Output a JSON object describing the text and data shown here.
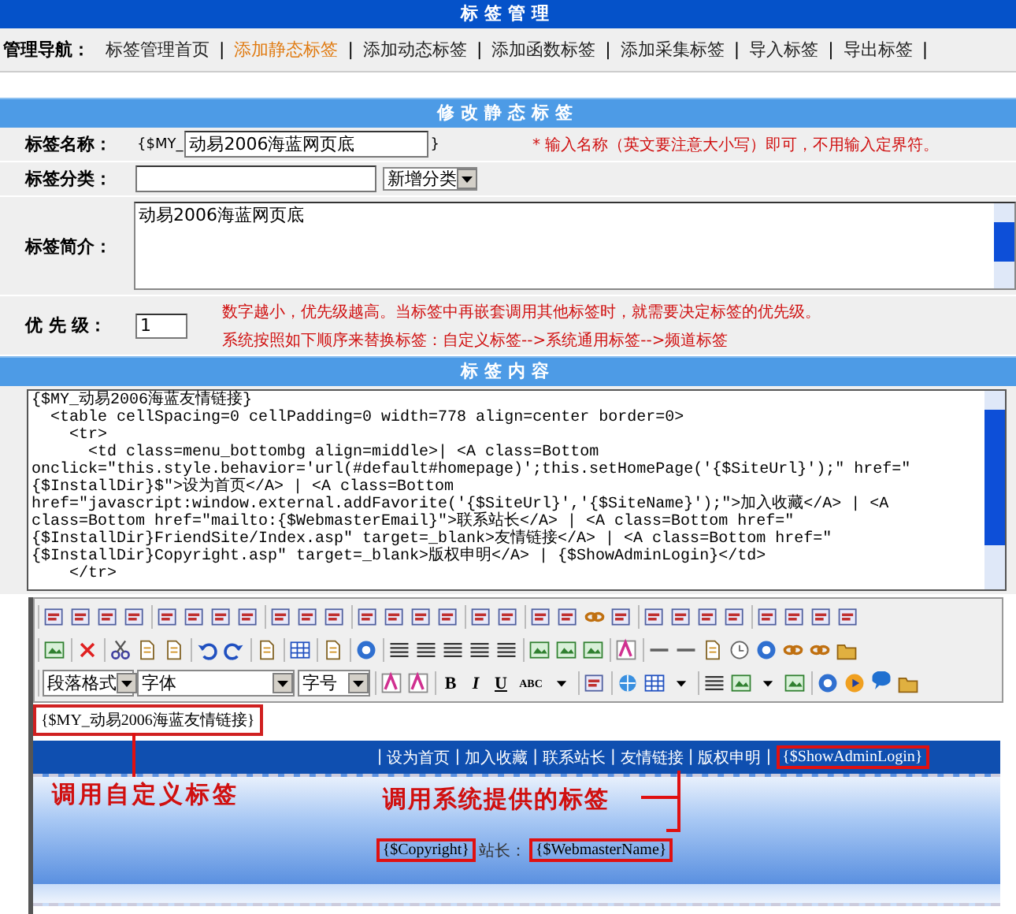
{
  "header": {
    "title": "标签管理"
  },
  "nav": {
    "label": "管理导航：",
    "separator": "|",
    "items": [
      {
        "label": "标签管理首页",
        "selected": false
      },
      {
        "label": "添加静态标签",
        "selected": true
      },
      {
        "label": "添加动态标签",
        "selected": false
      },
      {
        "label": "添加函数标签",
        "selected": false
      },
      {
        "label": "添加采集标签",
        "selected": false
      },
      {
        "label": "导入标签",
        "selected": false
      },
      {
        "label": "导出标签",
        "selected": false
      }
    ]
  },
  "form": {
    "title": "修改静态标签",
    "name": {
      "label": "标签名称：",
      "prefix": "{$MY_",
      "value": "动易2006海蓝网页底",
      "suffix": "}",
      "hint": "* 输入名称（英文要注意大小写）即可，不用输入定界符。"
    },
    "category": {
      "label": "标签分类：",
      "select": "新增分类"
    },
    "intro": {
      "label": "标签简介：",
      "value": "动易2006海蓝网页底"
    },
    "priority": {
      "label": "优 先 级：",
      "value": "1",
      "hints": [
        "数字越小，优先级越高。当标签中再嵌套调用其他标签时，就需要决定标签的优先级。",
        "系统按照如下顺序来替换标签：自定义标签-->系统通用标签-->频道标签"
      ]
    }
  },
  "content": {
    "title": "标签内容",
    "code": "{$MY_动易2006海蓝友情链接}\n  <table cellSpacing=0 cellPadding=0 width=778 align=center border=0>\n    <tr>\n      <td class=menu_bottombg align=middle>| <A class=Bottom onclick=\"this.style.behavior='url(#default#homepage)';this.setHomePage('{$SiteUrl}');\" href=\"{$InstallDir}$\">设为首页</A> | <A class=Bottom href=\"javascript:window.external.addFavorite('{$SiteUrl}','{$SiteName}');\">加入收藏</A> | <A class=Bottom href=\"mailto:{$WebmasterEmail}\">联系站长</A> | <A class=Bottom href=\"{$InstallDir}FriendSite/Index.asp\" target=_blank>友情链接</A> | <A class=Bottom href=\"{$InstallDir}Copyright.asp\" target=_blank>版权申明</A> | {$ShowAdminLogin}</td>\n    </tr>"
  },
  "editor": {
    "selects": [
      "段落格式",
      "字体",
      "字号"
    ],
    "format_buttons": [
      "B",
      "I",
      "U",
      "ABC"
    ],
    "tag_text": "{$MY_动易2006海蓝友情链接}",
    "preview": {
      "separator": "|",
      "links": [
        "设为首页",
        "加入收藏",
        "联系站长",
        "友情链接",
        "版权申明"
      ],
      "admin_tag": "{$ShowAdminLogin}",
      "copyright_tag": "{$Copyright}",
      "webmaster_label": "站长：",
      "webmaster_tag": "{$WebmasterName}"
    },
    "annotations": [
      "调用自定义标签",
      "调用系统提供的标签"
    ]
  }
}
